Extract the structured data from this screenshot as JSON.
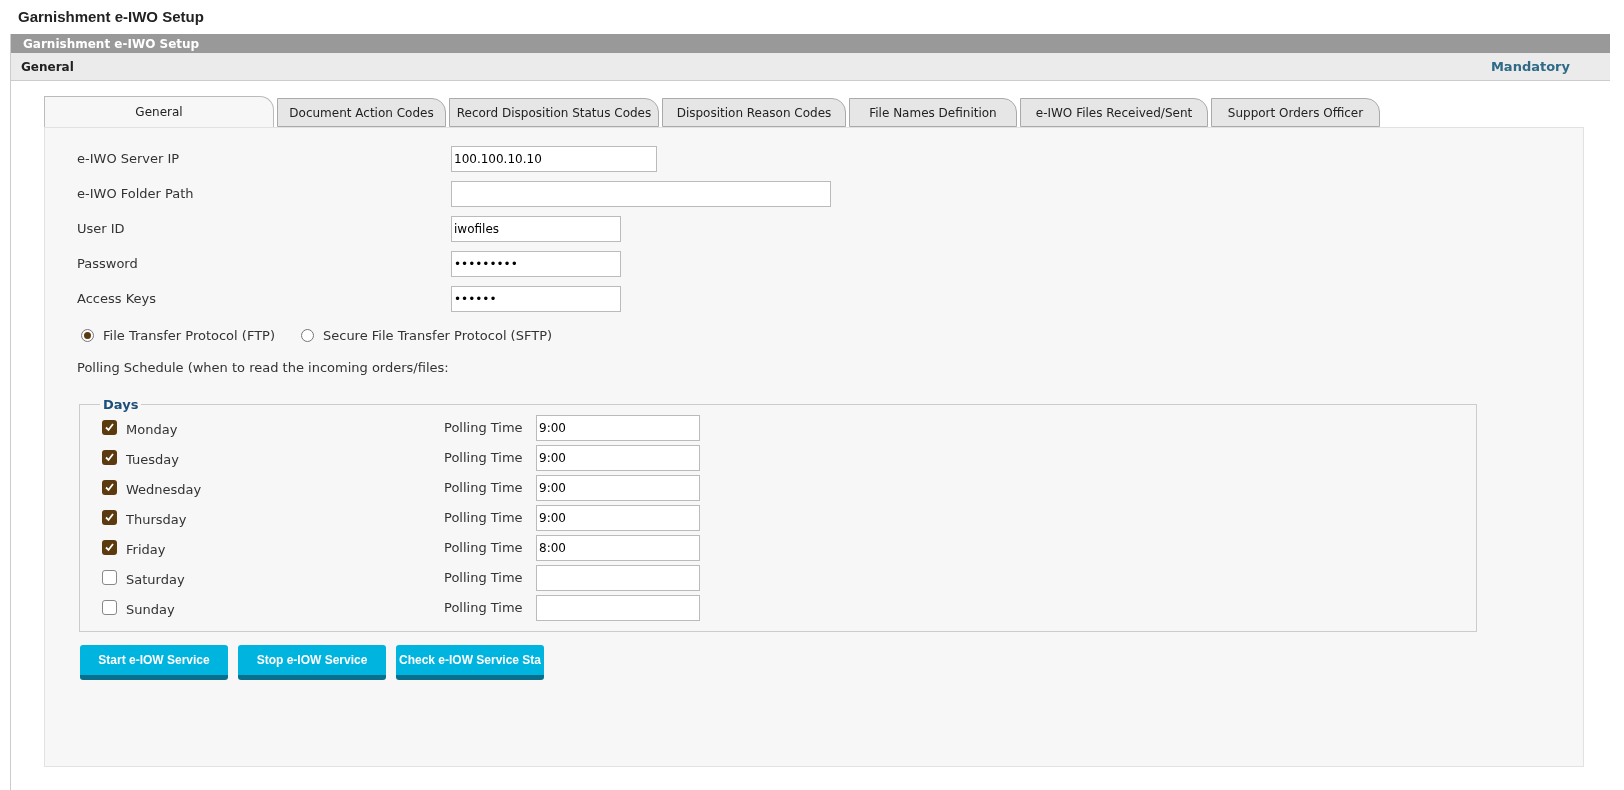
{
  "page_title": "Garnishment e-IWO Setup",
  "panel_header": "Garnishment e-IWO Setup",
  "section": {
    "title": "General",
    "note": "Mandatory"
  },
  "tabs": [
    {
      "label": "General",
      "selected": true
    },
    {
      "label": "Document Action Codes",
      "selected": false
    },
    {
      "label": "Record Disposition Status Codes",
      "selected": false
    },
    {
      "label": "Disposition Reason Codes",
      "selected": false
    },
    {
      "label": "File Names Definition",
      "selected": false
    },
    {
      "label": "e-IWO Files Received/Sent",
      "selected": false
    },
    {
      "label": "Support Orders Officer",
      "selected": false
    }
  ],
  "fields": [
    {
      "label": "e-IWO Server IP",
      "value": "100.100.10.10"
    },
    {
      "label": "e-IWO Folder Path"
    },
    {
      "label": "User ID",
      "value": "iwofiles"
    },
    {
      "label": "Password",
      "value": "•••••••••"
    },
    {
      "label": "Access Keys",
      "value": "••••••"
    }
  ],
  "protocols": [
    {
      "label": "File Transfer Protocol (FTP)",
      "selected": true
    },
    {
      "label": "Secure File Transfer Protocol (SFTP)",
      "selected": false
    }
  ],
  "polling_note": "Polling Schedule (when to read the incoming orders/files:",
  "days": {
    "legend": "Days",
    "rows": [
      {
        "day": "Monday",
        "checked": true,
        "time_label": "Polling Time",
        "time": "9:00"
      },
      {
        "day": "Tuesday",
        "checked": true,
        "time_label": "Polling Time",
        "time": "9:00"
      },
      {
        "day": "Wednesday",
        "checked": true,
        "time_label": "Polling Time",
        "time": "9:00"
      },
      {
        "day": "Thursday",
        "checked": true,
        "time_label": "Polling Time",
        "time": "9:00"
      },
      {
        "day": "Friday",
        "checked": true,
        "time_label": "Polling Time",
        "time": "8:00"
      },
      {
        "day": "Saturday",
        "checked": false,
        "time_label": "Polling Time"
      },
      {
        "day": "Sunday",
        "checked": false,
        "time_label": "Polling Time"
      }
    ]
  },
  "buttons": [
    "Start e-IOW Service",
    "Stop e-IOW Service",
    "Check e-IOW Service Sta"
  ]
}
